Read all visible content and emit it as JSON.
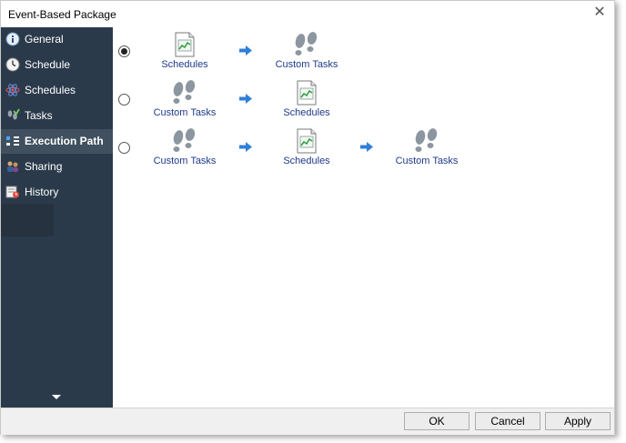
{
  "window": {
    "title": "Event-Based Package"
  },
  "sidebar": {
    "items": [
      {
        "label": "General",
        "icon": "info-icon",
        "active": false
      },
      {
        "label": "Schedule",
        "icon": "clock-icon",
        "active": false
      },
      {
        "label": "Schedules",
        "icon": "atom-icon",
        "active": false
      },
      {
        "label": "Tasks",
        "icon": "tasks-icon",
        "active": false
      },
      {
        "label": "Execution Path",
        "icon": "execution-path-icon",
        "active": true
      },
      {
        "label": "Sharing",
        "icon": "sharing-icon",
        "active": false
      },
      {
        "label": "History",
        "icon": "history-icon",
        "active": false
      }
    ]
  },
  "execution_paths": [
    {
      "selected": true,
      "steps": [
        "Schedules",
        "Custom Tasks"
      ]
    },
    {
      "selected": false,
      "steps": [
        "Custom Tasks",
        "Schedules"
      ]
    },
    {
      "selected": false,
      "steps": [
        "Custom Tasks",
        "Schedules",
        "Custom Tasks"
      ]
    }
  ],
  "buttons": {
    "ok": "OK",
    "cancel": "Cancel",
    "apply": "Apply"
  },
  "colors": {
    "sidebar_bg": "#2b3a4b",
    "sidebar_active": "#40505f",
    "link_text": "#1f3a8a",
    "arrow": "#2f7fd8"
  }
}
